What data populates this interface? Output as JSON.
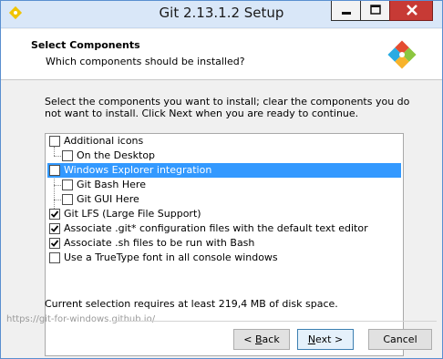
{
  "window": {
    "title": "Git 2.13.1.2 Setup"
  },
  "header": {
    "title": "Select Components",
    "subtitle": "Which components should be installed?"
  },
  "description": "Select the components you want to install; clear the components you do not want to install. Click Next when you are ready to continue.",
  "components": [
    {
      "label": "Additional icons",
      "checked": false,
      "level": 0,
      "selected": false
    },
    {
      "label": "On the Desktop",
      "checked": false,
      "level": 1,
      "selected": false
    },
    {
      "label": "Windows Explorer integration",
      "checked": false,
      "level": 0,
      "selected": true
    },
    {
      "label": "Git Bash Here",
      "checked": false,
      "level": 1,
      "selected": false
    },
    {
      "label": "Git GUI Here",
      "checked": false,
      "level": 1,
      "selected": false
    },
    {
      "label": "Git LFS (Large File Support)",
      "checked": true,
      "level": 0,
      "selected": false
    },
    {
      "label": "Associate .git* configuration files with the default text editor",
      "checked": true,
      "level": 0,
      "selected": false
    },
    {
      "label": "Associate .sh files to be run with Bash",
      "checked": true,
      "level": 0,
      "selected": false
    },
    {
      "label": "Use a TrueType font in all console windows",
      "checked": false,
      "level": 0,
      "selected": false
    }
  ],
  "status": "Current selection requires at least 219,4 MB of disk space.",
  "footer": {
    "link": "https://git-for-windows.github.io/"
  },
  "buttons": {
    "back": "< Back",
    "next": "Next >",
    "cancel": "Cancel"
  },
  "colors": {
    "selection": "#3399ff",
    "close_button": "#c73a35",
    "titlebar": "#d9e7f8"
  }
}
